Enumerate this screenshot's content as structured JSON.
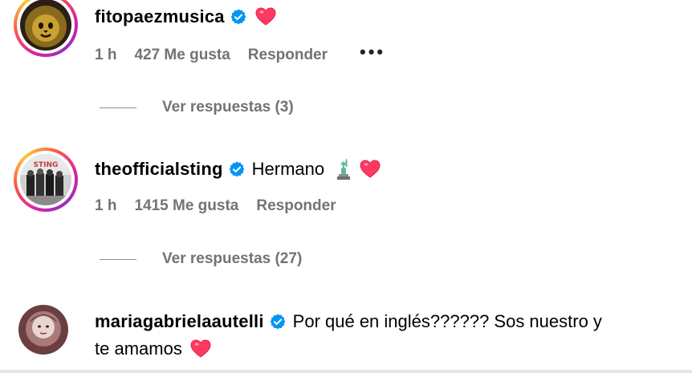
{
  "comments": [
    {
      "username": "fitopaezmusica",
      "text": "",
      "time": "1 h",
      "likes": "427 Me gusta",
      "reply_label": "Responder",
      "more_label": "•••",
      "view_replies": "Ver respuestas (3)"
    },
    {
      "username": "theofficialsting",
      "text": "Hermano",
      "time": "1 h",
      "likes": "1415 Me gusta",
      "reply_label": "Responder",
      "view_replies": "Ver respuestas (27)"
    },
    {
      "username": "mariagabrielaautelli",
      "text": "Por qué en inglés?????? Sos nuestro y",
      "text_line2": "te amamos"
    }
  ],
  "colors": {
    "verified": "#0095f6",
    "heart": "#ff3040",
    "meta_text": "#737373"
  },
  "icons": {
    "verified": "verified-badge-icon",
    "heart": "red-heart-emoji",
    "liberty": "statue-of-liberty-emoji"
  }
}
